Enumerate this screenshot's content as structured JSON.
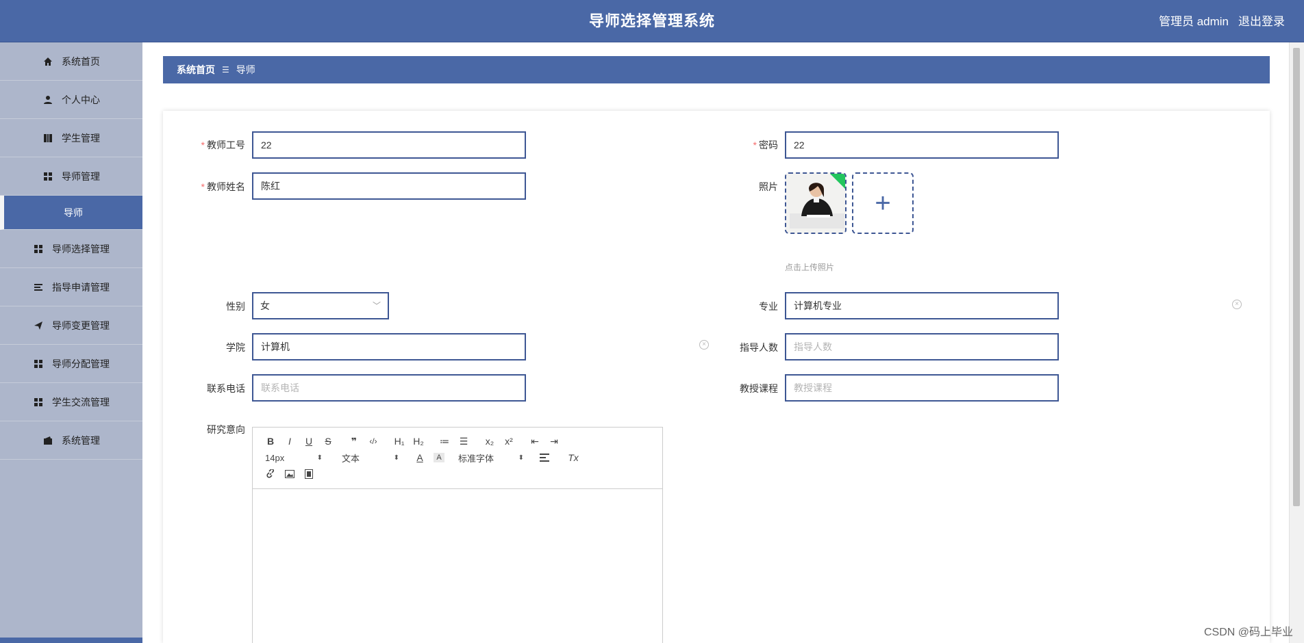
{
  "header": {
    "title": "导师选择管理系统",
    "user": "管理员 admin",
    "logout": "退出登录"
  },
  "sidebar": {
    "items": [
      {
        "label": "系统首页",
        "icon": "home-icon"
      },
      {
        "label": "个人中心",
        "icon": "user-icon"
      },
      {
        "label": "学生管理",
        "icon": "book-icon"
      },
      {
        "label": "导师管理",
        "icon": "grid-icon"
      },
      {
        "label": "导师",
        "icon": "",
        "active": true,
        "sub": true
      },
      {
        "label": "导师选择管理",
        "icon": "grid-icon"
      },
      {
        "label": "指导申请管理",
        "icon": "list-icon"
      },
      {
        "label": "导师变更管理",
        "icon": "send-icon"
      },
      {
        "label": "导师分配管理",
        "icon": "grid-icon"
      },
      {
        "label": "学生交流管理",
        "icon": "grid-icon"
      },
      {
        "label": "系统管理",
        "icon": "wallet-icon"
      }
    ]
  },
  "breadcrumb": {
    "home": "系统首页",
    "separator": "☰",
    "current": "导师"
  },
  "form": {
    "teacher_id": {
      "label": "教师工号",
      "value": "22",
      "required": true
    },
    "password": {
      "label": "密码",
      "value": "22",
      "required": true
    },
    "teacher_name": {
      "label": "教师姓名",
      "value": "陈红",
      "required": true
    },
    "photo": {
      "label": "照片",
      "tip": "点击上传照片"
    },
    "gender": {
      "label": "性别",
      "value": "女"
    },
    "major": {
      "label": "专业",
      "value": "计算机专业"
    },
    "college": {
      "label": "学院",
      "value": "计算机"
    },
    "guide_count": {
      "label": "指导人数",
      "placeholder": "指导人数"
    },
    "phone": {
      "label": "联系电话",
      "placeholder": "联系电话"
    },
    "courses": {
      "label": "教授课程",
      "placeholder": "教授课程"
    },
    "research": {
      "label": "研究意向"
    }
  },
  "editor": {
    "row1": [
      "B",
      "I",
      "U",
      "S",
      "❞",
      "‹/›",
      "H₁",
      "H₂",
      "≔",
      "☰",
      "x₂",
      "x²",
      "⇤",
      "⇥"
    ],
    "font_size": "14px",
    "text_type": "文本",
    "font_family": "标准字体",
    "clear_format": "Tx"
  },
  "colors": {
    "primary": "#4a68a6",
    "sidebar": "#adb6cb",
    "required": "#f56c6c"
  },
  "watermark": "CSDN @码上毕业"
}
